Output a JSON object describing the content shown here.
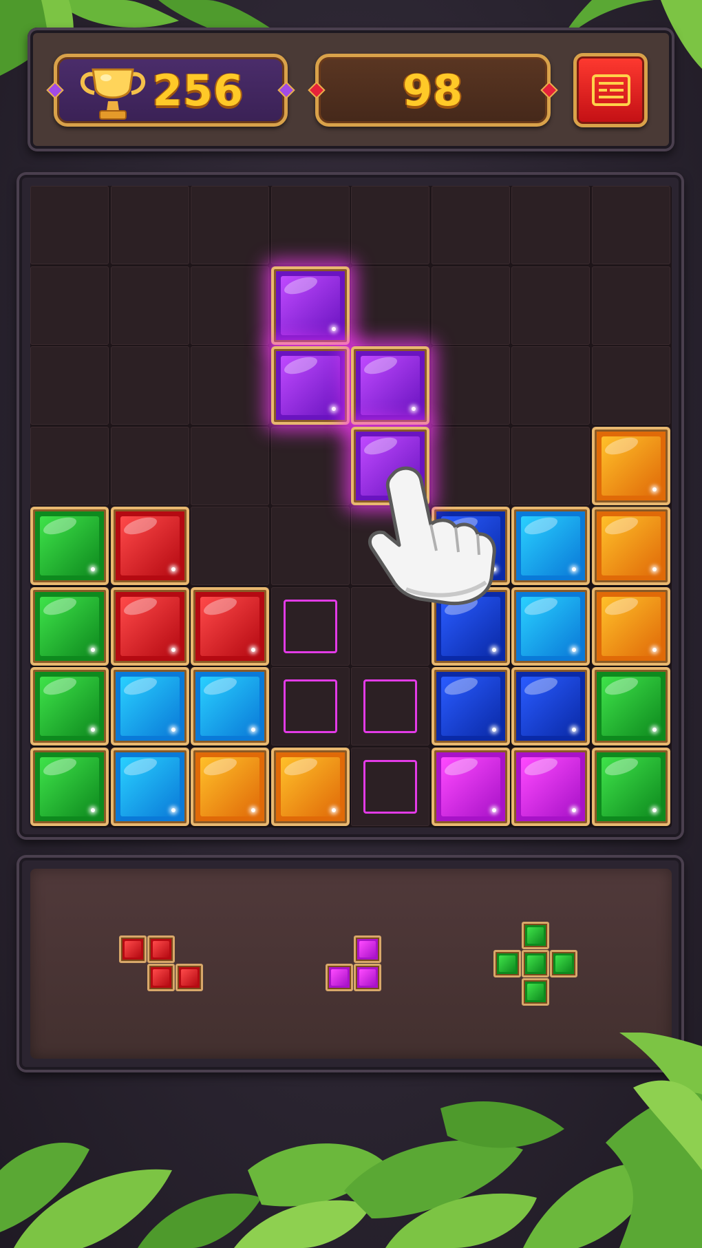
{
  "header": {
    "best_score": "256",
    "current_score": "98",
    "trophy_icon": "trophy-icon",
    "menu_icon": "menu-icon"
  },
  "colors": {
    "green": [
      "#3fe34a",
      "#0e8a1e"
    ],
    "red": [
      "#ff4a4a",
      "#b50a12"
    ],
    "blue": [
      "#2a5cff",
      "#0a2aa8"
    ],
    "cyan": [
      "#2ad0ff",
      "#0a7ad8"
    ],
    "orange": [
      "#ffc02a",
      "#e06a08"
    ],
    "magenta": [
      "#ff4aff",
      "#a812c8"
    ],
    "purple": [
      "#c04aff",
      "#6a14c0"
    ]
  },
  "board": {
    "size": 8,
    "cells": [
      {
        "row": 4,
        "col": 0,
        "color": "green"
      },
      {
        "row": 4,
        "col": 1,
        "color": "red"
      },
      {
        "row": 4,
        "col": 5,
        "color": "blue"
      },
      {
        "row": 4,
        "col": 6,
        "color": "cyan"
      },
      {
        "row": 4,
        "col": 7,
        "color": "orange"
      },
      {
        "row": 3,
        "col": 7,
        "color": "orange"
      },
      {
        "row": 5,
        "col": 0,
        "color": "green"
      },
      {
        "row": 5,
        "col": 1,
        "color": "red"
      },
      {
        "row": 5,
        "col": 2,
        "color": "red"
      },
      {
        "row": 5,
        "col": 5,
        "color": "blue"
      },
      {
        "row": 5,
        "col": 6,
        "color": "cyan"
      },
      {
        "row": 5,
        "col": 7,
        "color": "orange"
      },
      {
        "row": 6,
        "col": 0,
        "color": "green"
      },
      {
        "row": 6,
        "col": 1,
        "color": "cyan"
      },
      {
        "row": 6,
        "col": 2,
        "color": "cyan"
      },
      {
        "row": 6,
        "col": 5,
        "color": "blue"
      },
      {
        "row": 6,
        "col": 6,
        "color": "blue"
      },
      {
        "row": 6,
        "col": 7,
        "color": "green"
      },
      {
        "row": 7,
        "col": 0,
        "color": "green"
      },
      {
        "row": 7,
        "col": 1,
        "color": "cyan"
      },
      {
        "row": 7,
        "col": 2,
        "color": "orange"
      },
      {
        "row": 7,
        "col": 3,
        "color": "orange"
      },
      {
        "row": 7,
        "col": 5,
        "color": "magenta"
      },
      {
        "row": 7,
        "col": 6,
        "color": "magenta"
      },
      {
        "row": 7,
        "col": 7,
        "color": "green"
      }
    ],
    "dragging_piece": {
      "color": "purple",
      "cells": [
        {
          "row": 1,
          "col": 3
        },
        {
          "row": 2,
          "col": 3
        },
        {
          "row": 2,
          "col": 4
        },
        {
          "row": 3,
          "col": 4
        }
      ]
    },
    "drop_targets": [
      {
        "row": 5,
        "col": 3
      },
      {
        "row": 6,
        "col": 3
      },
      {
        "row": 6,
        "col": 4
      },
      {
        "row": 7,
        "col": 4
      }
    ]
  },
  "tray": {
    "pieces": [
      {
        "name": "z-piece",
        "color": "red",
        "cells": [
          [
            0,
            0
          ],
          [
            0,
            1
          ],
          [
            1,
            1
          ],
          [
            1,
            2
          ]
        ]
      },
      {
        "name": "small-l-piece",
        "color": "magenta",
        "cells": [
          [
            0,
            1
          ],
          [
            1,
            0
          ],
          [
            1,
            1
          ]
        ]
      },
      {
        "name": "plus-piece",
        "color": "green",
        "cells": [
          [
            0,
            1
          ],
          [
            1,
            0
          ],
          [
            1,
            1
          ],
          [
            1,
            2
          ],
          [
            2,
            1
          ]
        ]
      }
    ]
  },
  "hint_icon": "pointing-hand-icon"
}
